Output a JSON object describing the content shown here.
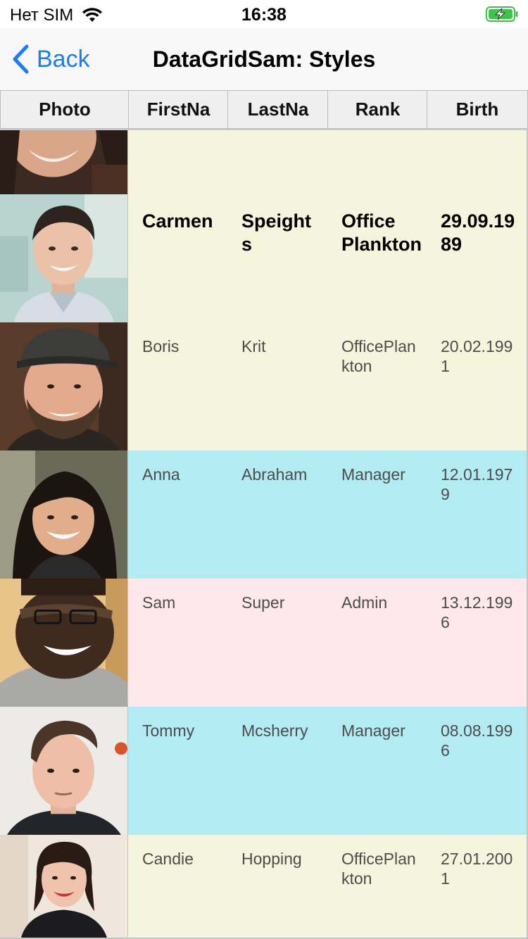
{
  "status_bar": {
    "carrier": "Нет SIM",
    "time": "16:38"
  },
  "nav": {
    "back_label": "Back",
    "title": "DataGridSam: Styles"
  },
  "grid": {
    "columns": [
      "Photo",
      "FirstNa",
      "LastNa",
      "Rank",
      "Birth"
    ],
    "rows": [
      {
        "first": "",
        "last": "",
        "rank": "",
        "birth": "",
        "style": "beige"
      },
      {
        "first": "Carmen",
        "last": "Speights",
        "rank": "Office Plankton",
        "birth": "29.09.1989",
        "style": "beige-bold"
      },
      {
        "first": "Boris",
        "last": "Krit",
        "rank": "OfficePlankton",
        "birth": "20.02.1991",
        "style": "beige"
      },
      {
        "first": "Anna",
        "last": "Abraham",
        "rank": "Manager",
        "birth": "12.01.1979",
        "style": "cyan"
      },
      {
        "first": "Sam",
        "last": "Super",
        "rank": "Admin",
        "birth": "13.12.1996",
        "style": "pink"
      },
      {
        "first": "Tommy",
        "last": "Mcsherry",
        "rank": "Manager",
        "birth": "08.08.1996",
        "style": "cyan"
      },
      {
        "first": "Candie",
        "last": "Hopping",
        "rank": "OfficePlankton",
        "birth": "27.01.2001",
        "style": "beige"
      }
    ]
  },
  "colors": {
    "accent": "#1b7cf5",
    "row_beige": "#f5f4dc",
    "row_cyan": "#b3ebf2",
    "row_pink": "#ffe8ec",
    "header_bg": "#efefef",
    "battery": "#3cc44a"
  }
}
